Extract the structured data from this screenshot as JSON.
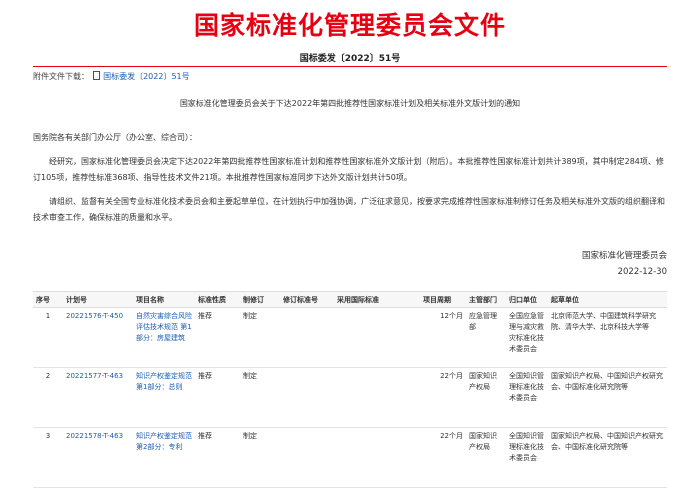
{
  "header": {
    "title": "国家标准化管理委员会文件",
    "doc_number": "国标委发〔2022〕51号"
  },
  "attachment": {
    "label": "附件文件下载：",
    "file": "国标委发〔2022〕51号"
  },
  "notice_title": "国家标准化管理委员会关于下达2022年第四批推荐性国家标准计划及相关标准外文版计划的通知",
  "salutation": "国务院各有关部门办公厅（办公室、综合司）：",
  "paragraphs": [
    "经研究，国家标准化管理委员会决定下达2022年第四批推荐性国家标准计划和推荐性国家标准外文版计划（附后）。本批推荐性国家标准计划共计389项，其中制定284项、修订105项，推荐性标准368项、指导性技术文件21项。本批推荐性国家标准同步下达外文版计划共计50项。",
    "请组织、监督有关全国专业标准化技术委员会和主要起草单位，在计划执行中加强协调，广泛征求意见，按要求完成推荐性国家标准制修订任务及相关标准外文版的组织翻译和技术审查工作，确保标准的质量和水平。"
  ],
  "signature": {
    "org": "国家标准化管理委员会",
    "date": "2022-12-30"
  },
  "table": {
    "headers": [
      "序号",
      "计划号",
      "项目名称",
      "标准性质",
      "制修订",
      "修订标准号",
      "采用国际标准",
      "项目周期",
      "主管部门",
      "归口单位",
      "起草单位"
    ],
    "rows": [
      [
        "1",
        "20221576-T-450",
        "自然灾害综合风险评估技术规范 第1部分：房屋建筑",
        "推荐",
        "制定",
        "",
        "",
        "12个月",
        "应急管理部",
        "全国应急管理与减灾救灾标准化技术委员会",
        "北京师范大学、中国建筑科学研究院、清华大学、北京科技大学等"
      ],
      [
        "2",
        "20221577-T-463",
        "知识产权鉴定规范 第1部分：总则",
        "推荐",
        "制定",
        "",
        "",
        "22个月",
        "国家知识产权局",
        "全国知识管理标准化技术委员会",
        "国家知识产权局、中国知识产权研究会、中国标准化研究院等"
      ],
      [
        "3",
        "20221578-T-463",
        "知识产权鉴定规范 第2部分：专利",
        "推荐",
        "制定",
        "",
        "",
        "22个月",
        "国家知识产权局",
        "全国知识管理标准化技术委员会",
        "国家知识产权局、中国知识产权研究会、中国标准化研究院等"
      ]
    ]
  },
  "colors": {
    "header_red": "#e60012",
    "link_blue": "#1a5bb5"
  }
}
